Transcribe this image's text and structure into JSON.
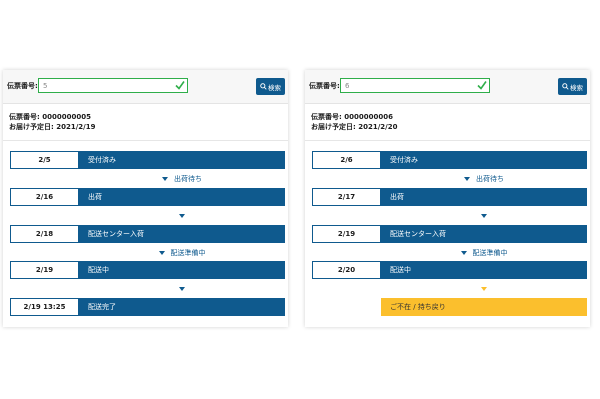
{
  "colors": {
    "accent": "#0f5a8e",
    "check": "#2fae4a",
    "warning": "#fbbf2d"
  },
  "panels": [
    {
      "search": {
        "label": "伝票番号:",
        "value": "5"
      },
      "search_button_label": "検索",
      "slip_number": "伝票番号: 0000000005",
      "delivery_date": "お届け予定日: 2021/2/19",
      "steps": [
        {
          "date": "2/5",
          "status": "受付済み"
        },
        {
          "connector": "出荷待ち"
        },
        {
          "date": "2/16",
          "status": "出荷"
        },
        {
          "connector": ""
        },
        {
          "date": "2/18",
          "status": "配送センター入荷"
        },
        {
          "connector": "配送準備中"
        },
        {
          "date": "2/19",
          "status": "配送中"
        },
        {
          "connector": ""
        },
        {
          "date": "2/19 13:25",
          "status": "配送完了"
        }
      ]
    },
    {
      "search": {
        "label": "伝票番号:",
        "value": "6"
      },
      "search_button_label": "検索",
      "slip_number": "伝票番号: 0000000006",
      "delivery_date": "お届け予定日: 2021/2/20",
      "steps": [
        {
          "date": "2/6",
          "status": "受付済み"
        },
        {
          "connector": "出荷待ち"
        },
        {
          "date": "2/17",
          "status": "出荷"
        },
        {
          "connector": ""
        },
        {
          "date": "2/19",
          "status": "配送センター入荷"
        },
        {
          "connector": "配送準備中"
        },
        {
          "date": "2/20",
          "status": "配送中"
        },
        {
          "connector": "",
          "warning": true
        },
        {
          "status": "ご不在 / 持ち戻り",
          "warning": true
        }
      ]
    }
  ]
}
